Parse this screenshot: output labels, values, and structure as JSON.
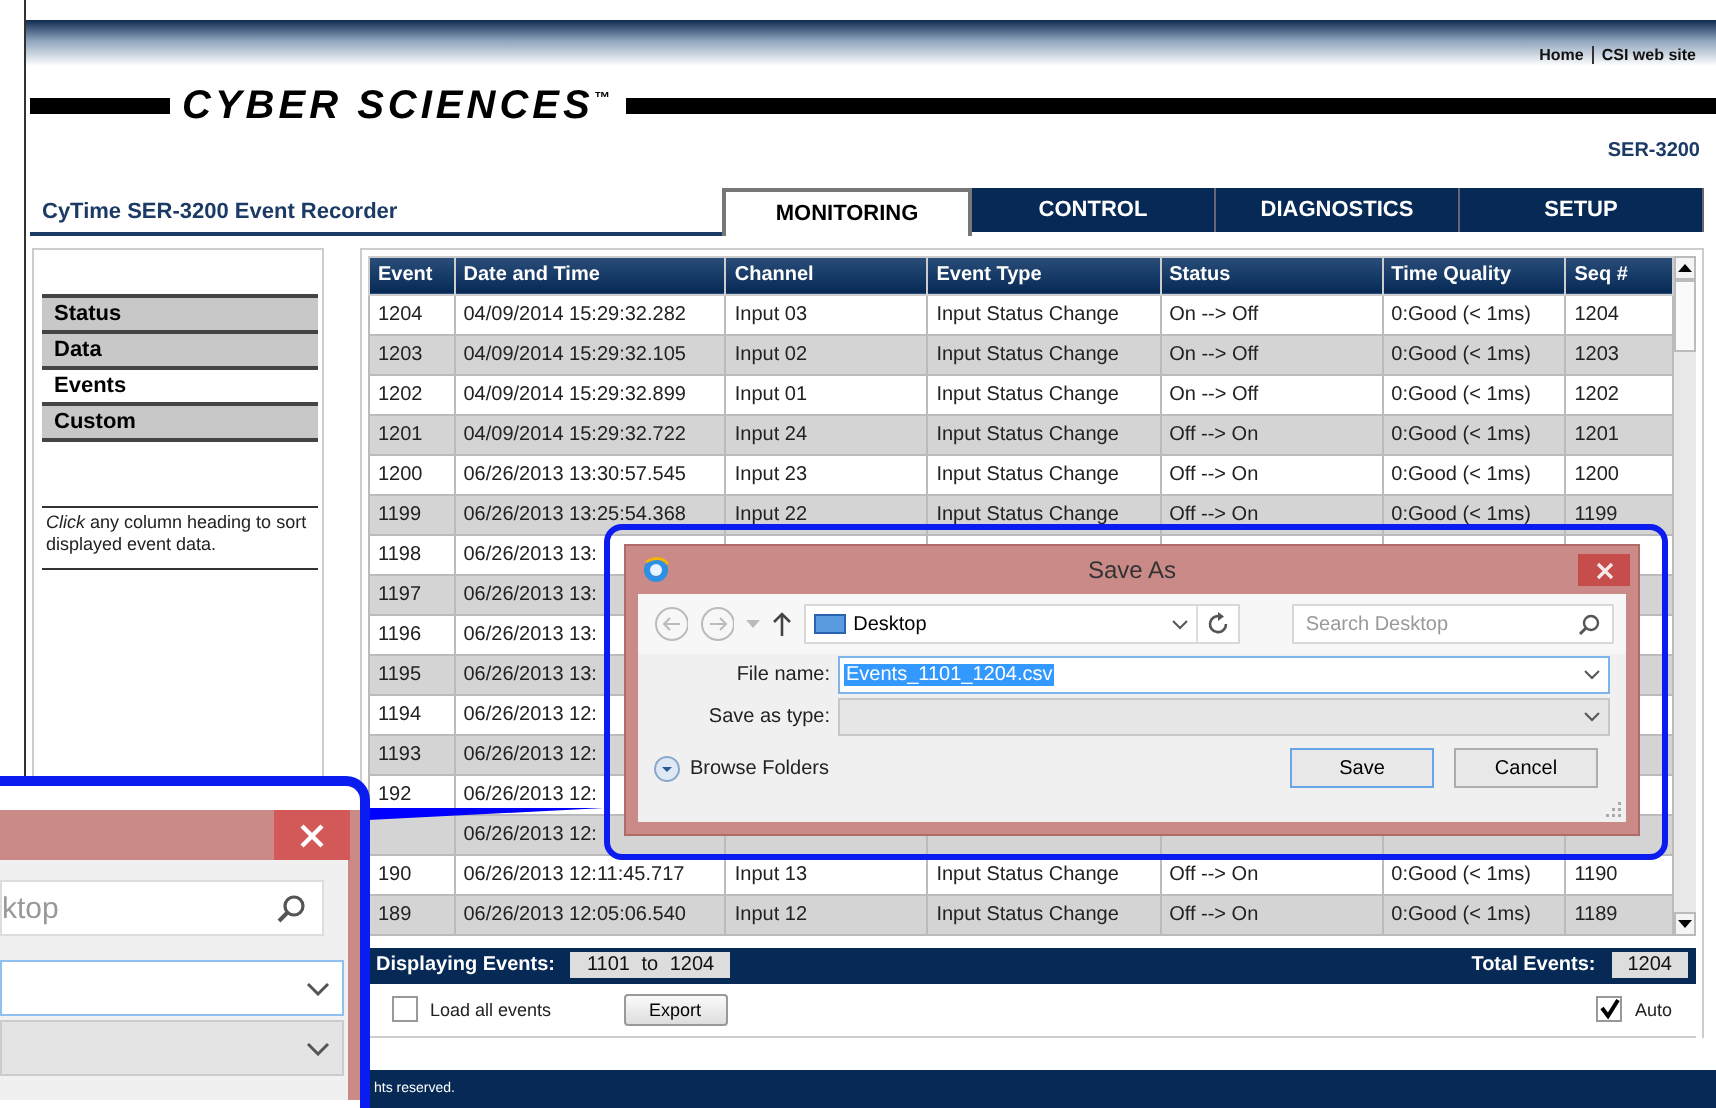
{
  "header": {
    "links": [
      "Home",
      "CSI web site"
    ]
  },
  "logo": {
    "text": "CYBER SCIENCES$^{™}$"
  },
  "product": "SER-3200",
  "app_title": "CyTime SER-3200 Event Recorder",
  "tabs": [
    {
      "label": "MONITORING",
      "selected": true
    },
    {
      "label": "CONTROL",
      "selected": false
    },
    {
      "label": "DIAGNOSTICS",
      "selected": false
    },
    {
      "label": "SETUP",
      "selected": false
    }
  ],
  "sidebar": {
    "items": [
      {
        "label": "Status",
        "selected": false
      },
      {
        "label": "Data",
        "selected": false
      },
      {
        "label": "Events",
        "selected": true
      },
      {
        "label": "Custom",
        "selected": false
      }
    ],
    "hint": "*Click* any column heading to sort displayed event data."
  },
  "table": {
    "columns": [
      "Event",
      "Date and Time",
      "Channel",
      "Event Type",
      "Status",
      "Time Quality",
      "Seq #"
    ],
    "rows": [
      {
        "event": "1204",
        "date_time": "04/09/2014 15:29:32.282",
        "channel": "Input 03",
        "event_type": "Input Status Change",
        "status": "On --> Off",
        "time_quality": "0:Good (< 1ms)",
        "seq": "1204"
      },
      {
        "event": "1203",
        "date_time": "04/09/2014 15:29:32.105",
        "channel": "Input 02",
        "event_type": "Input Status Change",
        "status": "On --> Off",
        "time_quality": "0:Good (< 1ms)",
        "seq": "1203"
      },
      {
        "event": "1202",
        "date_time": "04/09/2014 15:29:32.899",
        "channel": "Input 01",
        "event_type": "Input Status Change",
        "status": "On --> Off",
        "time_quality": "0:Good (< 1ms)",
        "seq": "1202"
      },
      {
        "event": "1201",
        "date_time": "04/09/2014 15:29:32.722",
        "channel": "Input 24",
        "event_type": "Input Status Change",
        "status": "Off --> On",
        "time_quality": "0:Good (< 1ms)",
        "seq": "1201"
      },
      {
        "event": "1200",
        "date_time": "06/26/2013 13:30:57.545",
        "channel": "Input 23",
        "event_type": "Input Status Change",
        "status": "Off --> On",
        "time_quality": "0:Good (< 1ms)",
        "seq": "1200"
      },
      {
        "event": "1199",
        "date_time": "06/26/2013 13:25:54.368",
        "channel": "Input 22",
        "event_type": "Input Status Change",
        "status": "Off --> On",
        "time_quality": "0:Good (< 1ms)",
        "seq": "1199"
      },
      {
        "event": "1198",
        "date_time": "06/26/2013 13:"
      },
      {
        "event": "1197",
        "date_time": "06/26/2013 13:"
      },
      {
        "event": "1196",
        "date_time": "06/26/2013 13:"
      },
      {
        "event": "1195",
        "date_time": "06/26/2013 13:"
      },
      {
        "event": "1194",
        "date_time": "06/26/2013 12:"
      },
      {
        "event": "1193",
        "date_time": "06/26/2013 12:"
      },
      {
        "event": "192",
        "date_time": "06/26/2013 12:"
      },
      {
        "date_time": "06/26/2013 12:"
      },
      {
        "event": "190",
        "date_time": "06/26/2013 12:11:45.717",
        "channel": "Input 13",
        "event_type": "Input Status Change",
        "status": "Off --> On",
        "time_quality": "0:Good (< 1ms)",
        "seq": "1190"
      },
      {
        "event": "189",
        "date_time": "06/26/2013 12:05:06.540",
        "channel": "Input 12",
        "event_type": "Input Status Change",
        "status": "Off --> On",
        "time_quality": "0:Good (< 1ms)",
        "seq": "1189"
      }
    ]
  },
  "status_bar": {
    "displaying_label": "Displaying Events:",
    "range": "1101 to 1204",
    "total_label": "Total Events:",
    "total": "1204"
  },
  "controls": {
    "load_all": {
      "label": "Load all events",
      "checked": false
    },
    "export_button": "Export",
    "auto": {
      "label": "Auto",
      "checked": true
    }
  },
  "footer": {
    "text": "hts reserved."
  },
  "save_dialog": {
    "title": "Save As",
    "location": "Desktop",
    "search": {
      "placeholder": "Search Desktop"
    },
    "file_name": {
      "label": "File name:",
      "value": "Events_1101_1204.csv"
    },
    "save_as_type": {
      "label": "Save as type:"
    },
    "browse_folders": "Browse Folders",
    "buttons": [
      "Save",
      "Cancel"
    ]
  },
  "callout": {
    "search": {
      "placeholder": "ktop"
    }
  }
}
